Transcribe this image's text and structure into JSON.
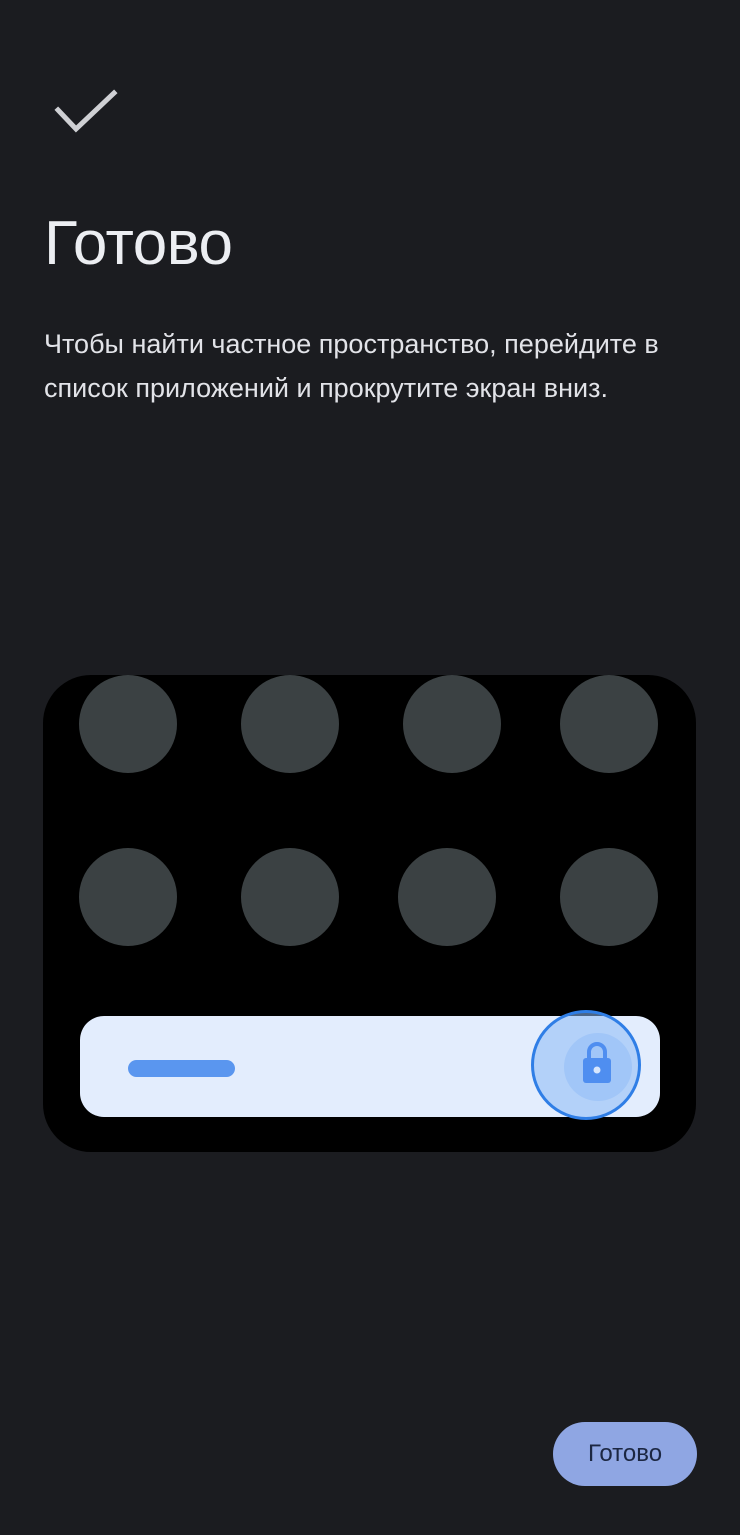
{
  "header": {
    "icon": "check-icon",
    "title": "Готово",
    "description": "Чтобы найти частное пространство, перейдите в список приложений и прокрутите экран вниз."
  },
  "illustration": {
    "app_icon_rows": 2,
    "app_icons_per_row": 4,
    "lock_icon": "lock-icon",
    "colors": {
      "background": "#000000",
      "app_icon": "#3b4143",
      "bar": "#e3edfd",
      "accent": "#2f7ee6"
    }
  },
  "footer": {
    "done_label": "Готово"
  },
  "colors": {
    "page_background": "#1b1c20",
    "button_background": "#8fa6e3"
  }
}
